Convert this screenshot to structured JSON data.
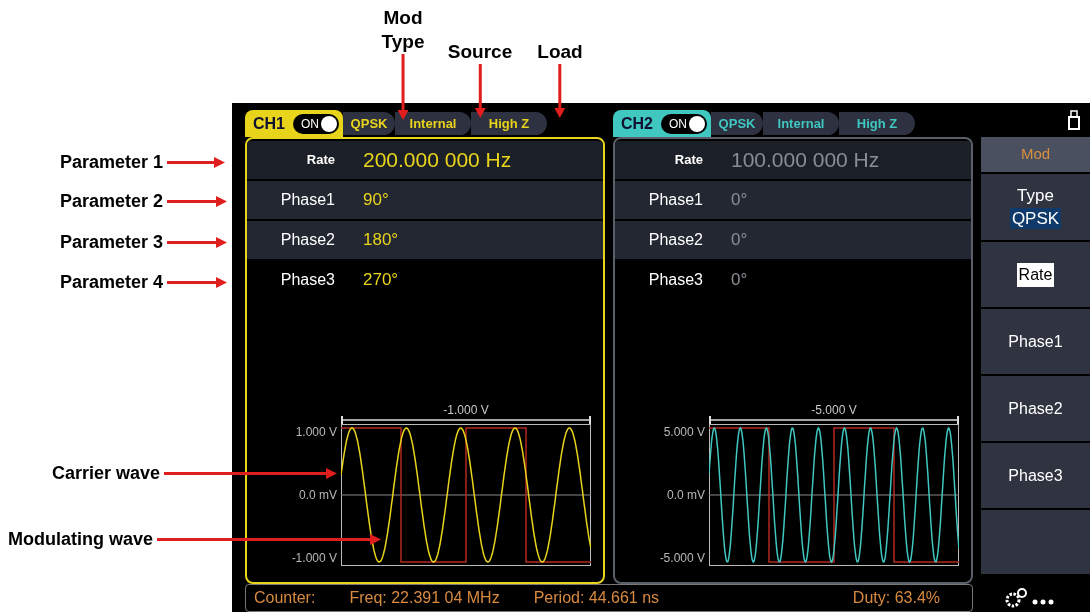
{
  "callouts_top": [
    {
      "lines": [
        "Mod",
        "Type"
      ]
    },
    {
      "lines": [
        "Source"
      ]
    },
    {
      "lines": [
        "Load"
      ]
    }
  ],
  "callouts_left": [
    {
      "label": "Parameter 1",
      "kind": "row"
    },
    {
      "label": "Parameter 2",
      "kind": "row"
    },
    {
      "label": "Parameter 3",
      "kind": "row"
    },
    {
      "label": "Parameter 4",
      "kind": "row"
    },
    {
      "label": "Carrier wave",
      "kind": "wave"
    },
    {
      "label": "Modulating wave",
      "kind": "wave"
    }
  ],
  "channels": [
    {
      "name": "CH1",
      "color": "#e8d41a",
      "selected": true,
      "on": true,
      "on_label": "ON",
      "mod_type": "QPSK",
      "source": "Internal",
      "load": "High Z",
      "params": [
        {
          "label": "Rate",
          "value": "200.000 000 Hz"
        },
        {
          "label": "Phase1",
          "value": "90°"
        },
        {
          "label": "Phase2",
          "value": "180°"
        },
        {
          "label": "Phase3",
          "value": "270°"
        }
      ],
      "wave": {
        "span": "-1.000 V",
        "y_top": "1.000 V",
        "y_mid": "0.0 mV",
        "y_bottom": "-1.000 V"
      }
    },
    {
      "name": "CH2",
      "color": "#3fc7c0",
      "selected": false,
      "on": true,
      "on_label": "ON",
      "mod_type": "QPSK",
      "source": "Internal",
      "load": "High Z",
      "params": [
        {
          "label": "Rate",
          "value": "100.000 000 Hz"
        },
        {
          "label": "Phase1",
          "value": "0°"
        },
        {
          "label": "Phase2",
          "value": "0°"
        },
        {
          "label": "Phase3",
          "value": "0°"
        }
      ],
      "wave": {
        "span": "-5.000 V",
        "y_top": "5.000 V",
        "y_mid": "0.0 mV",
        "y_bottom": "-5.000 V"
      }
    }
  ],
  "menu": [
    {
      "kind": "title",
      "label": "Mod"
    },
    {
      "kind": "option",
      "label": "Type",
      "value": "QPSK"
    },
    {
      "kind": "item",
      "label": "Rate",
      "selected": true
    },
    {
      "kind": "item",
      "label": "Phase1",
      "selected": false
    },
    {
      "kind": "item",
      "label": "Phase2",
      "selected": false
    },
    {
      "kind": "item",
      "label": "Phase3",
      "selected": false
    },
    {
      "kind": "blank"
    }
  ],
  "status_bar": {
    "counter": "Counter:",
    "freq": "Freq: 22.391 04 MHz",
    "period": "Period: 44.661 ns",
    "duty": "Duty: 63.4%"
  }
}
